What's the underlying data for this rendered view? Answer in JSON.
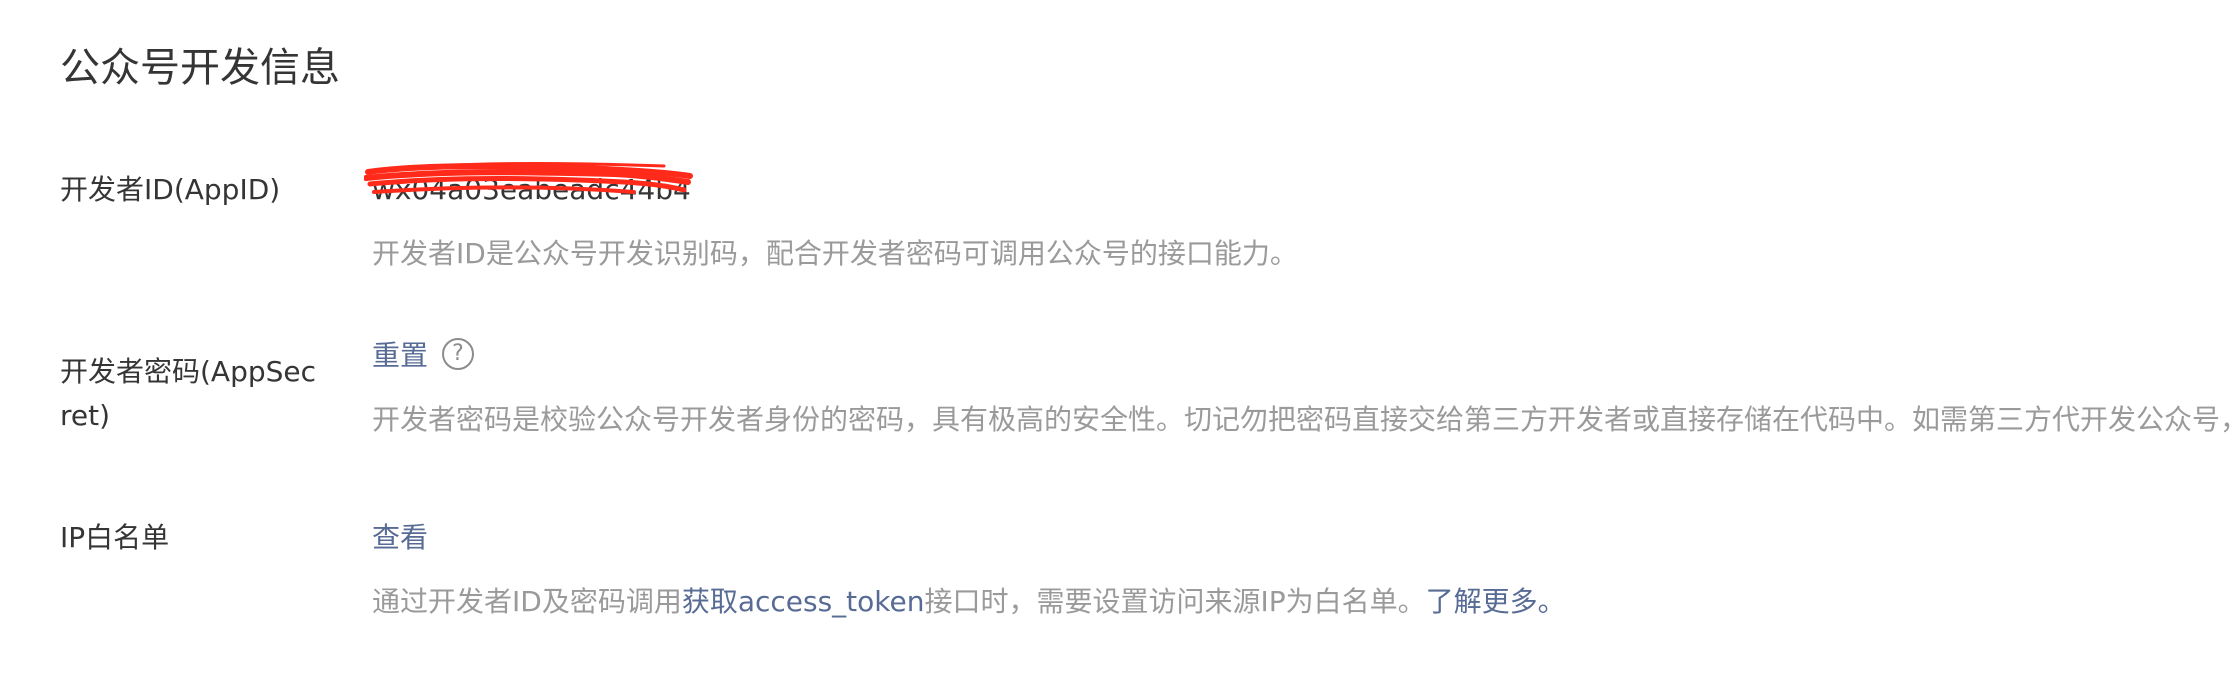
{
  "page": {
    "title": "公众号开发信息"
  },
  "appid": {
    "label": "开发者ID(AppID)",
    "value": "wx04a03eabeadc44b4",
    "description": "开发者ID是公众号开发识别码，配合开发者密码可调用公众号的接口能力。"
  },
  "appsecret": {
    "label": "开发者密码(AppSecret)",
    "reset_label": "重置",
    "help_icon": "question-circle-icon",
    "help_glyph": "?",
    "description": "开发者密码是校验公众号开发者身份的密码，具有极高的安全性。切记勿把密码直接交给第三方开发者或直接存储在代码中。如需第三方代开发公众号，"
  },
  "ip_whitelist": {
    "label": "IP白名单",
    "view_label": "查看",
    "description_prefix": "通过开发者ID及密码调用",
    "description_link": "获取access_token",
    "description_middle": "接口时，需要设置访问来源IP为白名单。",
    "learn_more_label": "了解更多。"
  },
  "colors": {
    "text": "#353535",
    "muted": "#9a9a9a",
    "link": "#576b95",
    "redaction": "#ff2a1a"
  }
}
